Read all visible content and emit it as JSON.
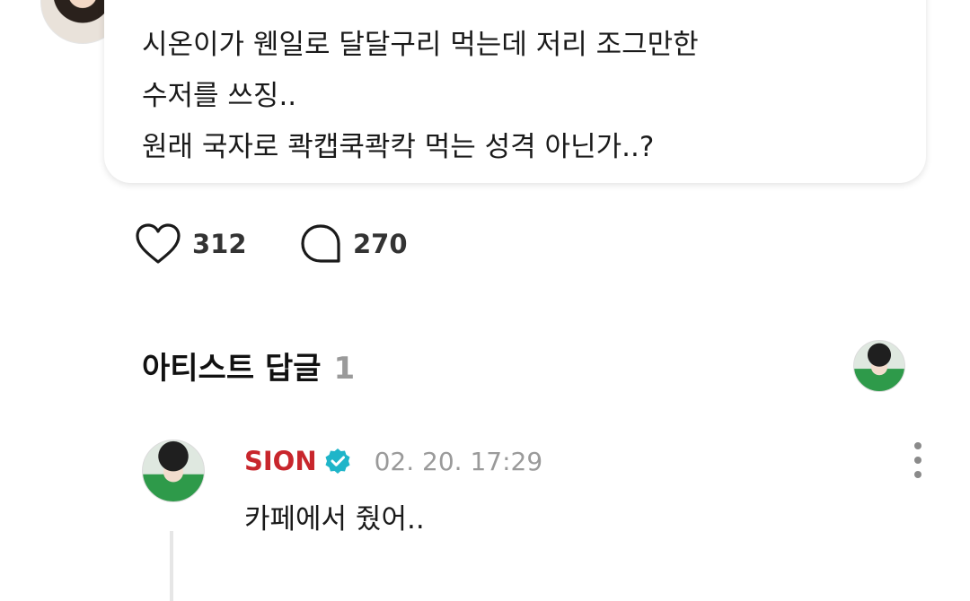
{
  "post": {
    "lines": [
      "시온이가 웬일로 달달구리 먹는데 저리 조그만한",
      "수저를 쓰징..",
      "원래 국자로 콱캡쿡콱칵 먹는 성격 아닌가..?"
    ]
  },
  "reactions": {
    "likes": "312",
    "comments": "270"
  },
  "artist_replies": {
    "title": "아티스트 답글",
    "count": "1"
  },
  "reply": {
    "author": "SION",
    "timestamp": "02. 20. 17:29",
    "text": "카페에서 줬어.."
  },
  "colors": {
    "author": "#c8262c",
    "verified": "#1fb5c9"
  },
  "icons": {
    "like": "heart-icon",
    "comment": "comment-bubble-icon",
    "verified": "verified-badge-icon",
    "more": "more-vertical-icon"
  }
}
